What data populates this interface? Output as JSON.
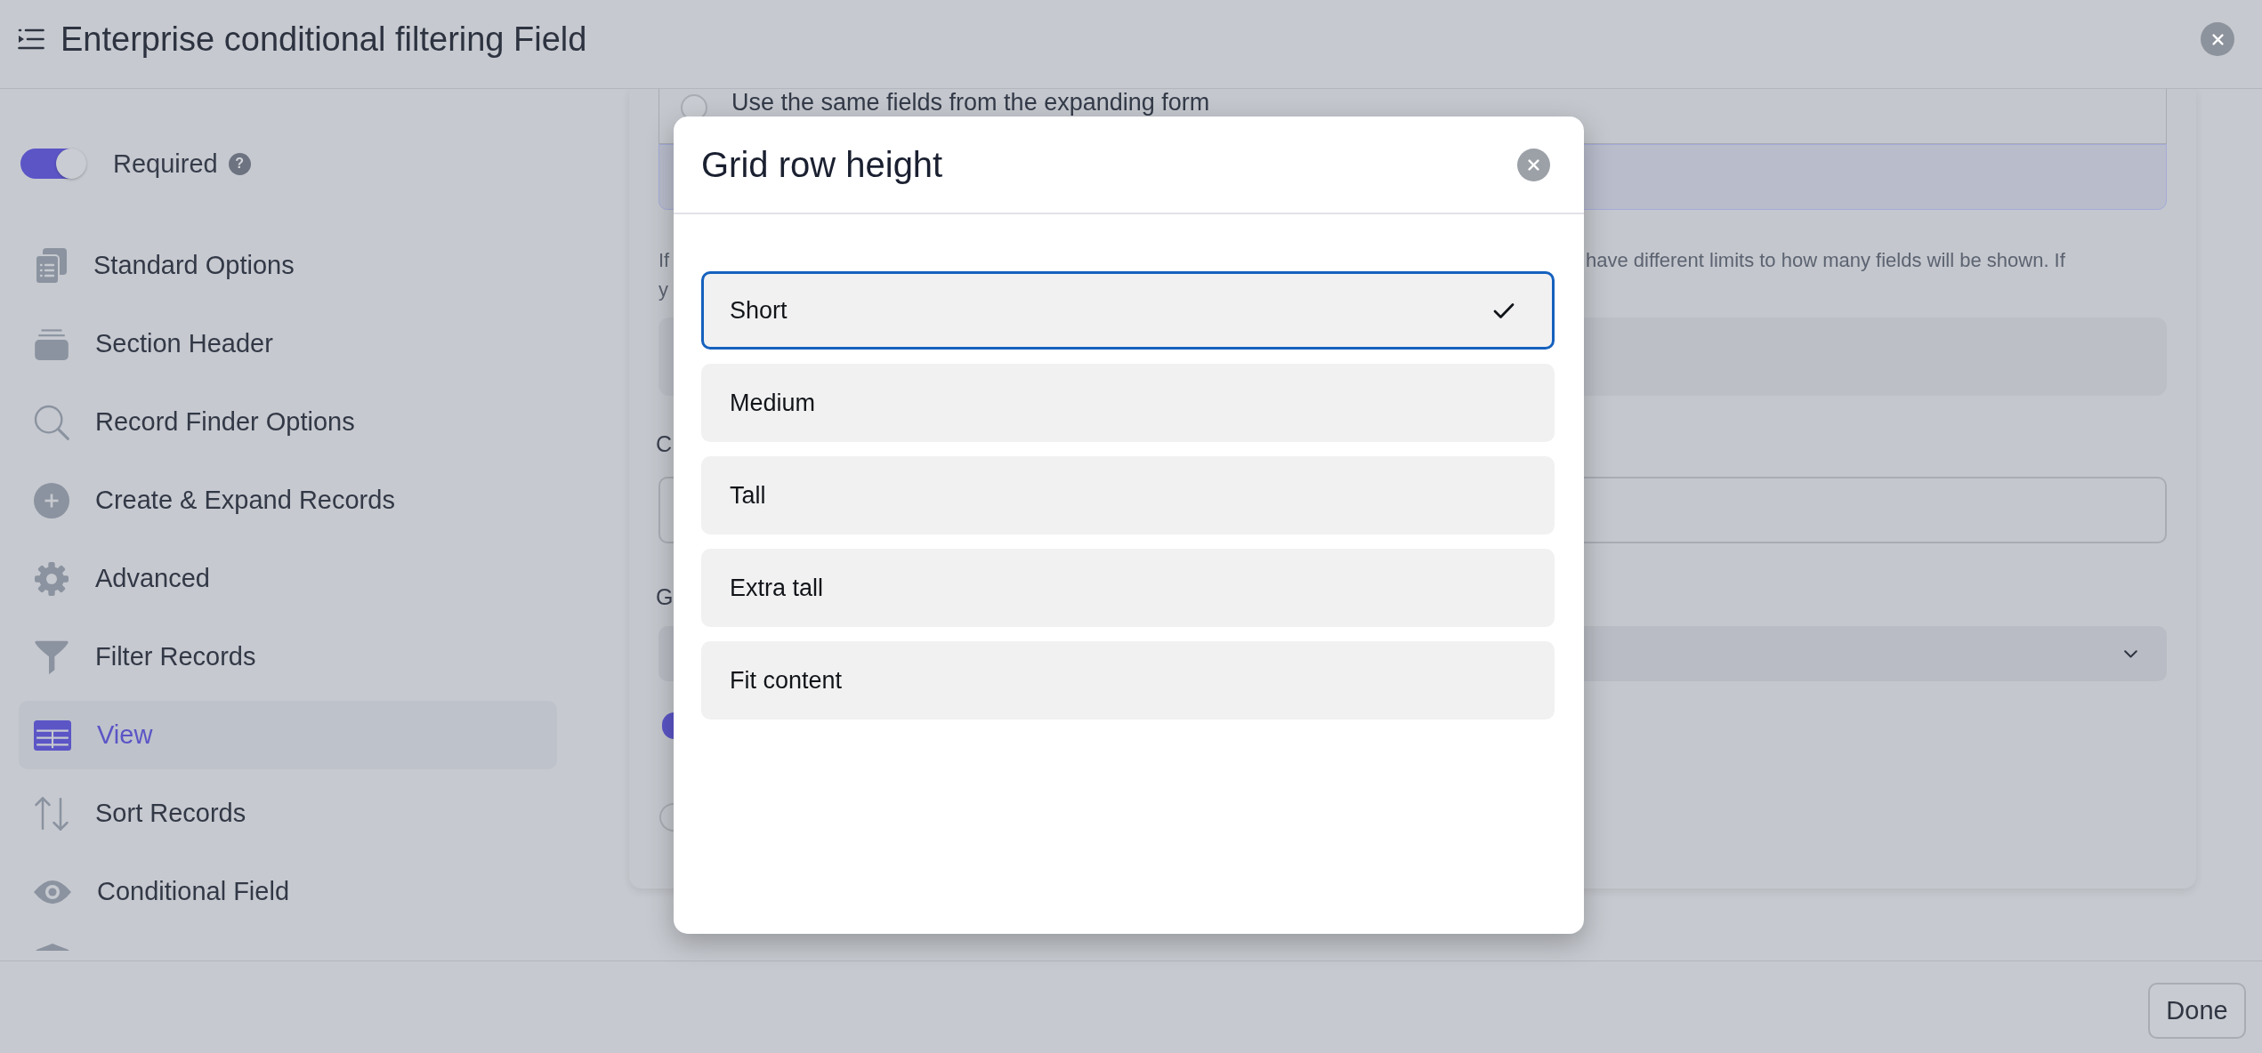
{
  "header": {
    "title": "Enterprise conditional filtering Field"
  },
  "sidebar": {
    "required": {
      "label": "Required",
      "on": true,
      "help": "?"
    },
    "items": [
      {
        "label": "Standard Options",
        "selected": false
      },
      {
        "label": "Section Header",
        "selected": false
      },
      {
        "label": "Record Finder Options",
        "selected": false
      },
      {
        "label": "Create & Expand Records",
        "selected": false
      },
      {
        "label": "Advanced",
        "selected": false
      },
      {
        "label": "Filter Records",
        "selected": false
      },
      {
        "label": "View",
        "selected": true
      },
      {
        "label": "Sort Records",
        "selected": false
      },
      {
        "label": "Conditional Field",
        "selected": false
      }
    ]
  },
  "content": {
    "choice_rows": [
      {
        "label": "Use the same fields from the expanding form",
        "selected": false
      },
      {
        "selected": true
      }
    ],
    "help_text": {
      "left_lines": [
        "If",
        "y"
      ],
      "right": "have different limits to how many fields will be shown. If"
    },
    "fields": [
      {
        "kind": "filled"
      },
      {
        "kind": "input",
        "label": "C"
      },
      {
        "kind": "select",
        "label": "G"
      }
    ],
    "switch": {
      "on": true
    },
    "radio": {
      "selected": false
    }
  },
  "modal": {
    "title": "Grid row height",
    "options": [
      {
        "label": "Short",
        "selected": true
      },
      {
        "label": "Medium",
        "selected": false
      },
      {
        "label": "Tall",
        "selected": false
      },
      {
        "label": "Extra tall",
        "selected": false
      },
      {
        "label": "Fit content",
        "selected": false
      }
    ]
  },
  "footer": {
    "buttons": [
      "Done"
    ]
  }
}
